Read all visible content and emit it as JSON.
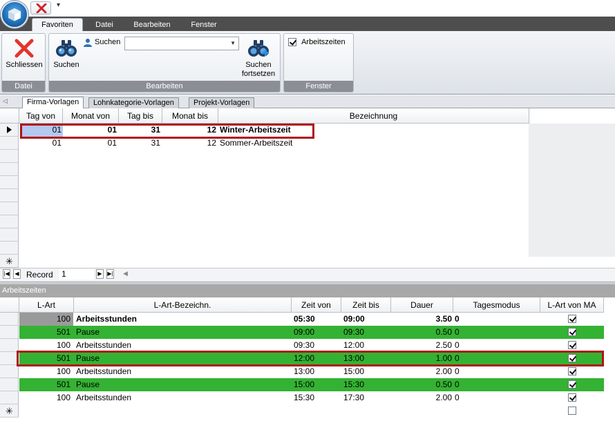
{
  "ribbon": {
    "tabs": [
      "Favoriten",
      "Datei",
      "Bearbeiten",
      "Fenster"
    ],
    "close_button": "Schliessen",
    "search_button": "Suchen",
    "search_label": "Suchen",
    "search_value": "",
    "search_next_button": [
      "Suchen",
      "fortsetzen"
    ],
    "arbeitszeiten_check": "Arbeitszeiten",
    "groups": [
      "Datei",
      "Bearbeiten",
      "Fenster"
    ]
  },
  "doc_tabs": [
    "Firma-Vorlagen",
    "Lohnkategorie-Vorlagen",
    "Projekt-Vorlagen"
  ],
  "grid1": {
    "headers": [
      "Tag von",
      "Monat von",
      "Tag bis",
      "Monat bis",
      "Bezeichnung"
    ],
    "rows": [
      {
        "tag_von": "01",
        "monat_von": "01",
        "tag_bis": "31",
        "monat_bis": "12",
        "bezeichnung": "Winter-Arbeitszeit"
      },
      {
        "tag_von": "01",
        "monat_von": "01",
        "tag_bis": "31",
        "monat_bis": "12",
        "bezeichnung": "Sommer-Arbeitszeit"
      }
    ],
    "record_label": "Record",
    "record_value": "1"
  },
  "panel": {
    "title": "Arbeitszeiten",
    "headers": [
      "L-Art",
      "L-Art-Bezeichn.",
      "Zeit von",
      "Zeit bis",
      "Dauer",
      "Tagesmodus",
      "L-Art von MA"
    ],
    "rows": [
      {
        "lart": "100",
        "bez": "Arbeitsstunden",
        "von": "05:30",
        "bis": "09:00",
        "dauer": "3.50",
        "modus": "0",
        "ma": true
      },
      {
        "lart": "501",
        "bez": "Pause",
        "von": "09:00",
        "bis": "09:30",
        "dauer": "0.50",
        "modus": "0",
        "ma": true
      },
      {
        "lart": "100",
        "bez": "Arbeitsstunden",
        "von": "09:30",
        "bis": "12:00",
        "dauer": "2.50",
        "modus": "0",
        "ma": true
      },
      {
        "lart": "501",
        "bez": "Pause",
        "von": "12:00",
        "bis": "13:00",
        "dauer": "1.00",
        "modus": "0",
        "ma": true
      },
      {
        "lart": "100",
        "bez": "Arbeitsstunden",
        "von": "13:00",
        "bis": "15:00",
        "dauer": "2.00",
        "modus": "0",
        "ma": true
      },
      {
        "lart": "501",
        "bez": "Pause",
        "von": "15:00",
        "bis": "15:30",
        "dauer": "0.50",
        "modus": "0",
        "ma": true
      },
      {
        "lart": "100",
        "bez": "Arbeitsstunden",
        "von": "15:30",
        "bis": "17:30",
        "dauer": "2.00",
        "modus": "0",
        "ma": true
      }
    ]
  },
  "colors": {
    "pause_row": "#34b233",
    "highlight": "#b01218",
    "ribbon_tabbar": "#4e4e4e"
  }
}
